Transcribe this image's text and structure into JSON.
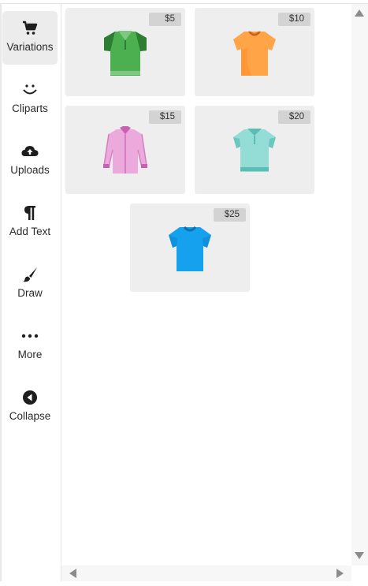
{
  "sidebar": {
    "items": [
      {
        "label": "Variations",
        "icon": "cart-icon",
        "active": true
      },
      {
        "label": "Cliparts",
        "icon": "smiley-icon",
        "active": false
      },
      {
        "label": "Uploads",
        "icon": "cloud-upload-icon",
        "active": false
      },
      {
        "label": "Add Text",
        "icon": "pilcrow-icon",
        "active": false
      },
      {
        "label": "Draw",
        "icon": "brush-icon",
        "active": false
      },
      {
        "label": "More",
        "icon": "more-dots-icon",
        "active": false
      },
      {
        "label": "Collapse",
        "icon": "collapse-left-icon",
        "active": false
      }
    ]
  },
  "variations": [
    {
      "price": "$5",
      "product": "green-polo-shirt",
      "color": "#4caf50"
    },
    {
      "price": "$10",
      "product": "orange-tshirt",
      "color": "#ff9a3d"
    },
    {
      "price": "$15",
      "product": "pink-dress-shirt",
      "color": "#e8a3d9"
    },
    {
      "price": "$20",
      "product": "teal-polo-shirt",
      "color": "#8fd8d2"
    },
    {
      "price": "$25",
      "product": "blue-tshirt",
      "color": "#14a0ee"
    }
  ],
  "colors": {
    "active_nav_bg": "#ececec",
    "card_bg": "#eeeeee",
    "price_badge_bg": "#d3d3d3"
  }
}
